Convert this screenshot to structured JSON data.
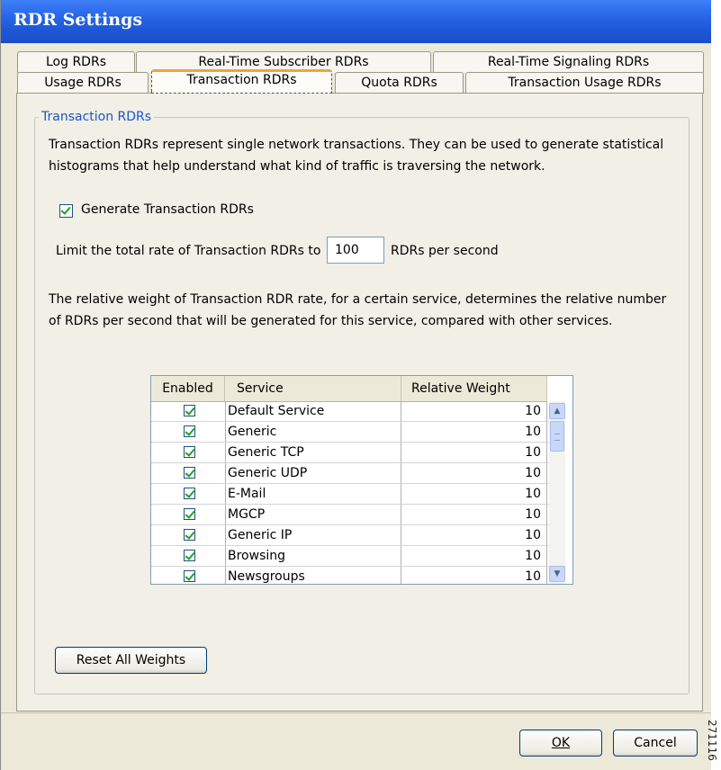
{
  "window": {
    "title": "RDR Settings"
  },
  "tabs": {
    "row1": [
      "Log RDRs",
      "Real-Time Subscriber RDRs",
      "Real-Time Signaling RDRs"
    ],
    "row2": [
      "Usage RDRs",
      "Transaction RDRs",
      "Quota RDRs",
      "Transaction Usage RDRs"
    ],
    "active": "Transaction RDRs"
  },
  "group": {
    "legend": "Transaction RDRs",
    "description": "Transaction RDRs represent single network transactions. They can be used to generate statistical histograms that help understand what kind of traffic is traversing the network.",
    "generate_label": "Generate Transaction RDRs",
    "generate_checked": true,
    "limit_prefix": "Limit the total rate of Transaction RDRs to",
    "limit_value": "100",
    "limit_suffix": "RDRs per second",
    "weight_description": "The relative weight of Transaction RDR rate, for a certain service, determines the relative number of RDRs per second that will be generated for this service, compared with other services."
  },
  "table": {
    "headers": {
      "enabled": "Enabled",
      "service": "Service",
      "weight": "Relative Weight"
    },
    "rows": [
      {
        "enabled": true,
        "service": "Default Service",
        "weight": "10"
      },
      {
        "enabled": true,
        "service": "Generic",
        "weight": "10"
      },
      {
        "enabled": true,
        "service": "Generic TCP",
        "weight": "10"
      },
      {
        "enabled": true,
        "service": "Generic UDP",
        "weight": "10"
      },
      {
        "enabled": true,
        "service": "E-Mail",
        "weight": "10"
      },
      {
        "enabled": true,
        "service": "MGCP",
        "weight": "10"
      },
      {
        "enabled": true,
        "service": "Generic IP",
        "weight": "10"
      },
      {
        "enabled": true,
        "service": "Browsing",
        "weight": "10"
      },
      {
        "enabled": true,
        "service": "Newsgroups",
        "weight": "10"
      }
    ]
  },
  "buttons": {
    "reset": "Reset All Weights",
    "ok": "OK",
    "cancel": "Cancel"
  },
  "icons": {
    "scroll_up": "arrow-up-icon",
    "scroll_down": "arrow-down-icon",
    "check": "checkmark-icon"
  },
  "colors": {
    "titlebar": "#2a68e8",
    "legend": "#1a56c7",
    "active_tab_accent": "#f3a23a",
    "check": "#21a121"
  },
  "side_label": "271116"
}
